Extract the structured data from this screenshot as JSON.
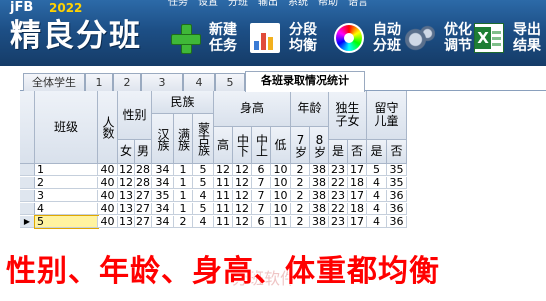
{
  "header": {
    "logo_small": "jFB",
    "logo_year": "2022",
    "title": "精良分班",
    "menu": [
      "任务",
      "设置",
      "分班",
      "输出",
      "系统",
      "帮助",
      "语言"
    ],
    "toolbar": [
      {
        "label": "新建任务",
        "icon": "add-icon"
      },
      {
        "label": "分段均衡",
        "icon": "bar-chart-icon"
      },
      {
        "label": "自动分班",
        "icon": "color-wheel-icon"
      },
      {
        "label": "优化调节",
        "icon": "gears-icon"
      },
      {
        "label": "导出结果",
        "icon": "excel-icon"
      }
    ]
  },
  "tabs": [
    "全体学生",
    "1",
    "2",
    "3",
    "4",
    "5",
    "各班录取情况统计"
  ],
  "active_tab": 6,
  "grid": {
    "headers": {
      "class": "班级",
      "count": "人数",
      "gender": "性别",
      "female": "女",
      "male": "男",
      "ethnicity": "民族",
      "han": "汉族",
      "man": "满族",
      "mongol": "蒙古族",
      "height": "身高",
      "h_high": "高",
      "h_midhigh": "中上",
      "h_midlow": "中下",
      "h_low": "低",
      "age": "年龄",
      "age7": "7岁",
      "age8": "8岁",
      "only_child": "独生子女",
      "left_behind": "留守儿童",
      "yes": "是",
      "no": "否"
    },
    "rows": [
      {
        "name": "1",
        "values": [
          "40",
          "12",
          "28",
          "34",
          "1",
          "5",
          "12",
          "12",
          "6",
          "10",
          "2",
          "38",
          "23",
          "17",
          "5",
          "35"
        ]
      },
      {
        "name": "2",
        "values": [
          "40",
          "12",
          "28",
          "34",
          "1",
          "5",
          "11",
          "12",
          "7",
          "10",
          "2",
          "38",
          "22",
          "18",
          "4",
          "35"
        ]
      },
      {
        "name": "3",
        "values": [
          "40",
          "13",
          "27",
          "35",
          "1",
          "4",
          "11",
          "12",
          "7",
          "10",
          "2",
          "38",
          "23",
          "17",
          "4",
          "36"
        ]
      },
      {
        "name": "4",
        "values": [
          "40",
          "13",
          "27",
          "34",
          "1",
          "5",
          "11",
          "12",
          "7",
          "10",
          "2",
          "38",
          "22",
          "18",
          "4",
          "36"
        ]
      },
      {
        "name": "5",
        "values": [
          "40",
          "13",
          "27",
          "34",
          "2",
          "4",
          "11",
          "12",
          "6",
          "11",
          "2",
          "38",
          "23",
          "17",
          "4",
          "36"
        ]
      }
    ],
    "current_row": 4
  },
  "overlay": {
    "caption": "性别、年龄、身高、体重都均衡",
    "watermark": "分班软件"
  },
  "colors": {
    "header_bg": "#1d4f86",
    "caption": "#ff0000",
    "accent_year": "#ffd200"
  }
}
